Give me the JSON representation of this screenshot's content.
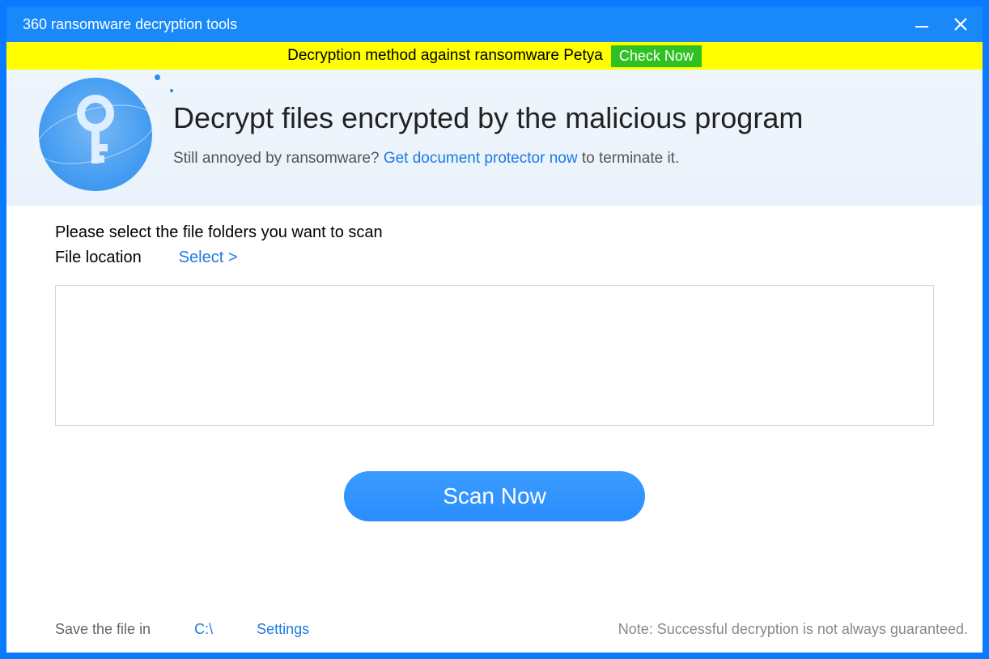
{
  "titlebar": {
    "title": "360 ransomware decryption tools"
  },
  "banner": {
    "text": "Decryption method against ransomware Petya",
    "button": "Check Now"
  },
  "hero": {
    "title": "Decrypt files encrypted by the malicious program",
    "sub_prefix": "Still annoyed by ransomware? ",
    "link": "Get document protector now",
    "sub_suffix": " to terminate it."
  },
  "main": {
    "instruction": "Please select the file folders you want to scan",
    "file_location_label": "File location",
    "select_label": "Select >",
    "scan_button": "Scan Now"
  },
  "footer": {
    "save_label": "Save the file in",
    "save_path": "C:\\",
    "settings": "Settings",
    "note": "Note: Successful decryption is not always guaranteed."
  }
}
